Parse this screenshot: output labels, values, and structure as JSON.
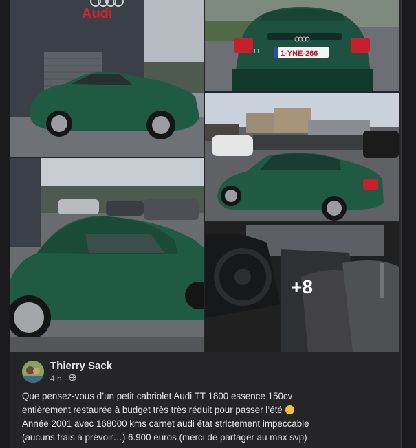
{
  "post": {
    "author": "Thierry Sack",
    "time": "4 h",
    "separator": "·",
    "privacy_icon": "globe-icon",
    "line1": "Que pensez-vous d’un petit cabriolet Audi TT 1800 essence 150cv",
    "line2": "entièrement restaurée à budget très très réduit pour passer l’été",
    "emoji": "wink-face-emoji",
    "line3": "Année 2001 avec 168000 kms carnet audi état strictement impeccable",
    "line4": "(aucuns frais à prévoir…) 6.900 euros (merci de partager au max svp)"
  },
  "photos": {
    "p1_sign": "Audi",
    "p2_plate": "1-YNE-266",
    "p2_badge": "TT",
    "more_count": "+8"
  },
  "colors": {
    "car_green": "#1f5a44",
    "post_bg": "#252527",
    "page_bg": "#1b1b1d",
    "text": "#e4e6eb",
    "meta": "#b0b3b8"
  }
}
